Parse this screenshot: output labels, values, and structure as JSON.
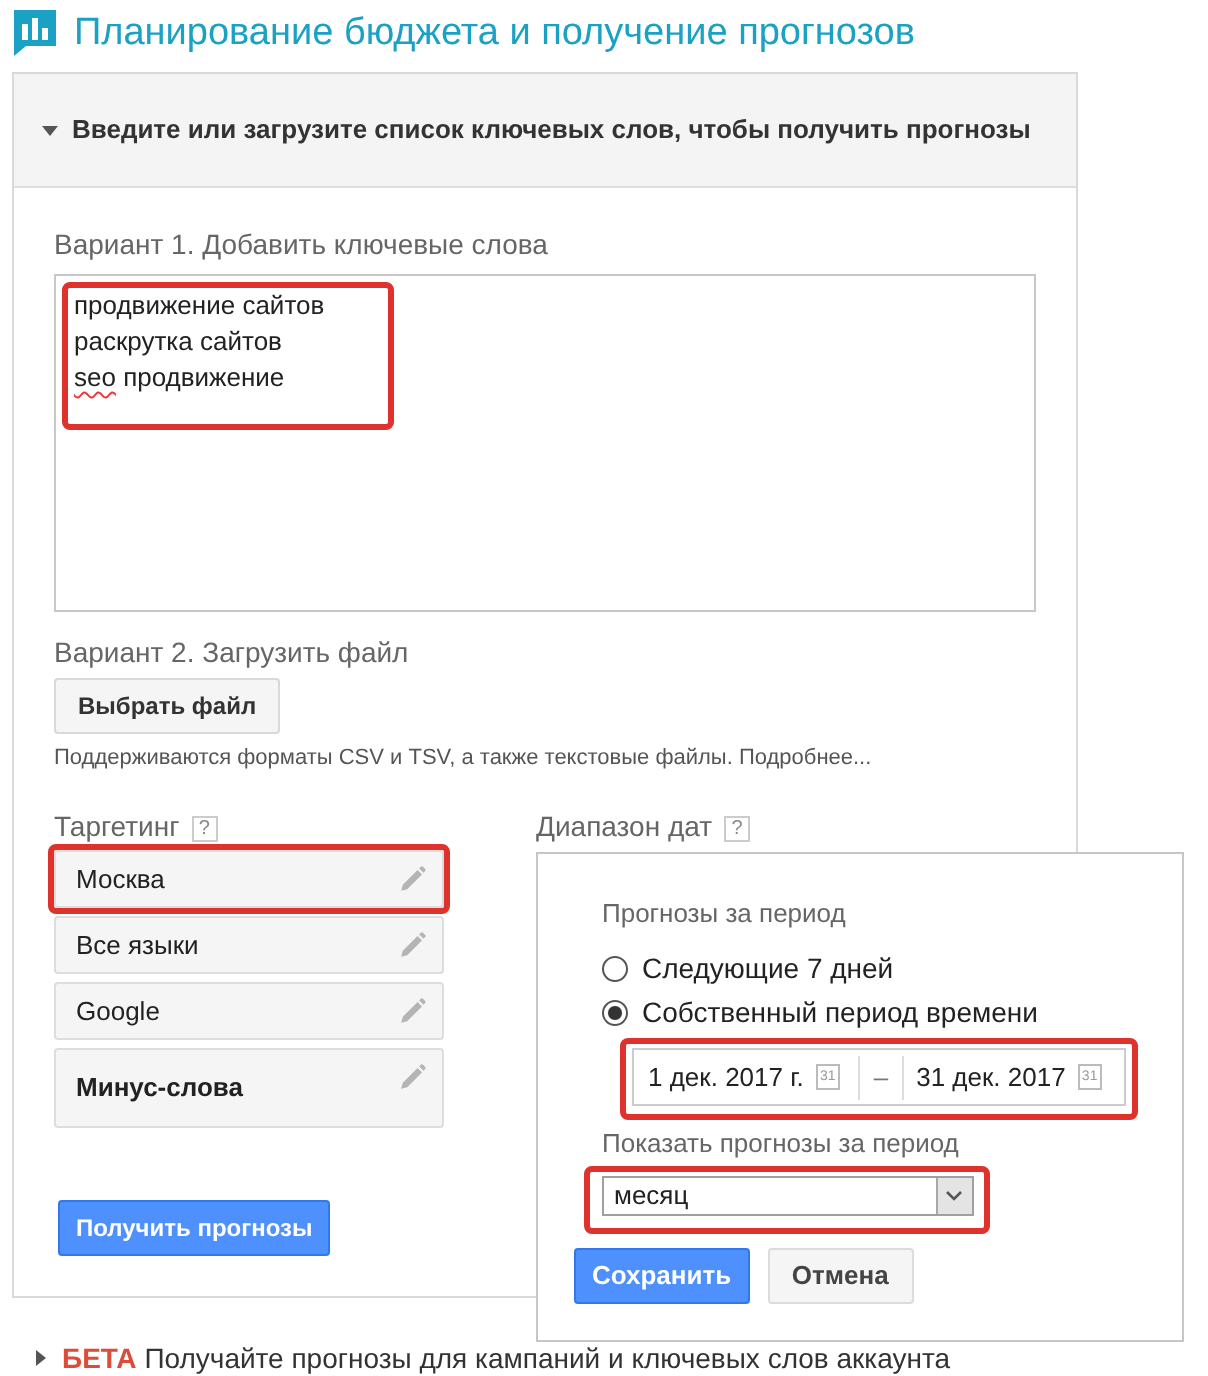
{
  "header": {
    "title": "Планирование бюджета и получение прогнозов"
  },
  "panel": {
    "heading": "Введите или загрузите список ключевых слов, чтобы получить прогнозы",
    "expanded": true
  },
  "option_1": {
    "label": "Вариант 1. Добавить ключевые слова",
    "highlighted": true,
    "keywords": [
      {
        "words": [
          {
            "text": "продвижение",
            "misspelled": false
          },
          {
            "text": "сайтов",
            "misspelled": false
          }
        ]
      },
      {
        "words": [
          {
            "text": "раскрутка",
            "misspelled": false
          },
          {
            "text": "сайтов",
            "misspelled": false
          }
        ]
      },
      {
        "words": [
          {
            "text": "seo",
            "misspelled": true
          },
          {
            "text": "продвижение",
            "misspelled": false
          }
        ]
      }
    ]
  },
  "option_2": {
    "label": "Вариант 2. Загрузить файл",
    "button": "Выбрать файл",
    "hint": "Поддерживаются форматы CSV и TSV, а также текстовые файлы.",
    "link": "Подробнее..."
  },
  "targeting": {
    "label": "Таргетинг",
    "help": "?",
    "items": [
      {
        "text": "Москва",
        "kind": "value",
        "highlighted": true
      },
      {
        "text": "Все языки",
        "kind": "value",
        "highlighted": false
      },
      {
        "text": "Google",
        "kind": "value",
        "highlighted": false
      },
      {
        "text": "Минус-слова",
        "kind": "group",
        "highlighted": false
      }
    ]
  },
  "forecast_button": "Получить прогнозы",
  "date_range": {
    "label": "Диапазон дат",
    "help": "?",
    "popup": {
      "title": "Прогнозы за период",
      "options": [
        {
          "label": "Следующие 7 дней",
          "selected": false
        },
        {
          "label": "Собственный период времени",
          "selected": true
        }
      ],
      "range": {
        "start": "1 дек. 2017 г.",
        "start_calendar": "31",
        "separator": "–",
        "end": "31 дек. 2017",
        "end_calendar": "31",
        "highlighted": true
      },
      "granularity": {
        "label": "Показать прогнозы за период",
        "value": "месяц",
        "highlighted": true
      },
      "buttons": [
        {
          "label": "Сохранить",
          "kind": "primary"
        },
        {
          "label": "Отмена",
          "kind": "secondary"
        }
      ]
    }
  },
  "beta": {
    "expanded": false,
    "badge": "БЕТА",
    "text": "Получайте прогнозы для кампаний и ключевых слов аккаунта"
  }
}
